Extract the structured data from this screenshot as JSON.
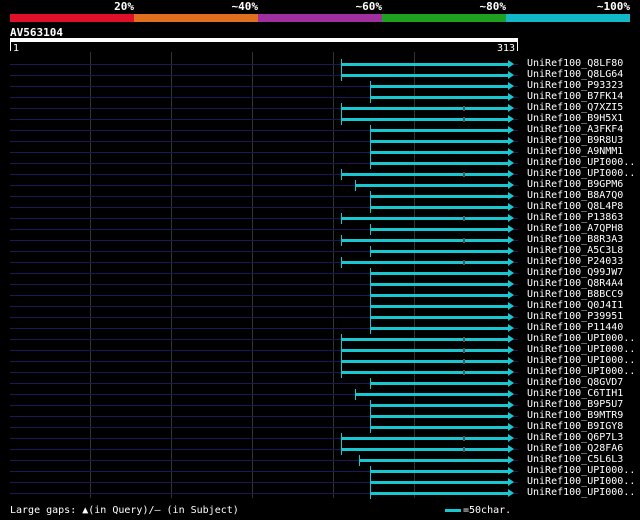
{
  "legend": {
    "segments": [
      "#e0102a",
      "#e07020",
      "#a030a0",
      "#20a020",
      "#10b8c8"
    ],
    "labels": [
      "20%",
      "~40%",
      "~60%",
      "~80%",
      "~100%"
    ]
  },
  "query": {
    "name": "AV563104",
    "start": "1",
    "end": "313"
  },
  "hits": [
    {
      "name": "UniRef100_Q8LF80",
      "start": 130,
      "cap": true,
      "gap": false
    },
    {
      "name": "UniRef100_Q8LG64",
      "start": 130,
      "cap": true,
      "gap": false
    },
    {
      "name": "UniRef100_P93323",
      "start": 148,
      "cap": true,
      "gap": false
    },
    {
      "name": "UniRef100_B7FK14",
      "start": 148,
      "cap": true,
      "gap": false
    },
    {
      "name": "UniRef100_Q7XZI5",
      "start": 130,
      "cap": true,
      "gap": true
    },
    {
      "name": "UniRef100_B9H5X1",
      "start": 130,
      "cap": true,
      "gap": true
    },
    {
      "name": "UniRef100_A3FKF4",
      "start": 148,
      "cap": true,
      "gap": false
    },
    {
      "name": "UniRef100_B9R8U3",
      "start": 148,
      "cap": true,
      "gap": false
    },
    {
      "name": "UniRef100_A9NMM1",
      "start": 148,
      "cap": true,
      "gap": false
    },
    {
      "name": "UniRef100_UPI000..",
      "start": 148,
      "cap": true,
      "gap": false
    },
    {
      "name": "UniRef100_UPI000..",
      "start": 130,
      "cap": true,
      "gap": true
    },
    {
      "name": "UniRef100_B9GPM6",
      "start": 139,
      "cap": true,
      "gap": false
    },
    {
      "name": "UniRef100_B8A7Q0",
      "start": 148,
      "cap": true,
      "gap": false
    },
    {
      "name": "UniRef100_Q8L4P8",
      "start": 148,
      "cap": true,
      "gap": false
    },
    {
      "name": "UniRef100_P13863",
      "start": 130,
      "cap": true,
      "gap": true
    },
    {
      "name": "UniRef100_A7QPH8",
      "start": 148,
      "cap": true,
      "gap": false
    },
    {
      "name": "UniRef100_B8R3A3",
      "start": 130,
      "cap": true,
      "gap": true
    },
    {
      "name": "UniRef100_A5C3L8",
      "start": 148,
      "cap": true,
      "gap": false
    },
    {
      "name": "UniRef100_P24033",
      "start": 130,
      "cap": true,
      "gap": true
    },
    {
      "name": "UniRef100_Q99JW7",
      "start": 148,
      "cap": true,
      "gap": false
    },
    {
      "name": "UniRef100_Q8R4A4",
      "start": 148,
      "cap": true,
      "gap": false
    },
    {
      "name": "UniRef100_B8BCC9",
      "start": 148,
      "cap": true,
      "gap": false
    },
    {
      "name": "UniRef100_Q0J4I1",
      "start": 148,
      "cap": true,
      "gap": false
    },
    {
      "name": "UniRef100_P39951",
      "start": 148,
      "cap": true,
      "gap": false
    },
    {
      "name": "UniRef100_P11440",
      "start": 148,
      "cap": true,
      "gap": false
    },
    {
      "name": "UniRef100_UPI000..",
      "start": 130,
      "cap": true,
      "gap": true
    },
    {
      "name": "UniRef100_UPI000..",
      "start": 130,
      "cap": true,
      "gap": true
    },
    {
      "name": "UniRef100_UPI000..",
      "start": 130,
      "cap": true,
      "gap": true
    },
    {
      "name": "UniRef100_UPI000..",
      "start": 130,
      "cap": true,
      "gap": true
    },
    {
      "name": "UniRef100_Q8GVD7",
      "start": 148,
      "cap": true,
      "gap": false
    },
    {
      "name": "UniRef100_C6TIH1",
      "start": 139,
      "cap": true,
      "gap": false
    },
    {
      "name": "UniRef100_B9P5U7",
      "start": 148,
      "cap": true,
      "gap": false
    },
    {
      "name": "UniRef100_B9MTR9",
      "start": 148,
      "cap": true,
      "gap": false
    },
    {
      "name": "UniRef100_B9IGY8",
      "start": 148,
      "cap": true,
      "gap": false
    },
    {
      "name": "UniRef100_Q6P7L3",
      "start": 130,
      "cap": true,
      "gap": true
    },
    {
      "name": "UniRef100_Q28FA6",
      "start": 130,
      "cap": true,
      "gap": true
    },
    {
      "name": "UniRef100_C5L6L3",
      "start": 141,
      "cap": true,
      "gap": false
    },
    {
      "name": "UniRef100_UPI000..",
      "start": 148,
      "cap": true,
      "gap": false
    },
    {
      "name": "UniRef100_UPI000..",
      "start": 148,
      "cap": true,
      "gap": false
    },
    {
      "name": "UniRef100_UPI000..",
      "start": 148,
      "cap": true,
      "gap": false
    }
  ],
  "footer": {
    "gaps_label": "Large gaps: ▲(in Query)/— (in Subject)",
    "scale_label": "=50char."
  },
  "colors": {
    "hit": "#18c8d0",
    "base": "#1a1a55"
  }
}
